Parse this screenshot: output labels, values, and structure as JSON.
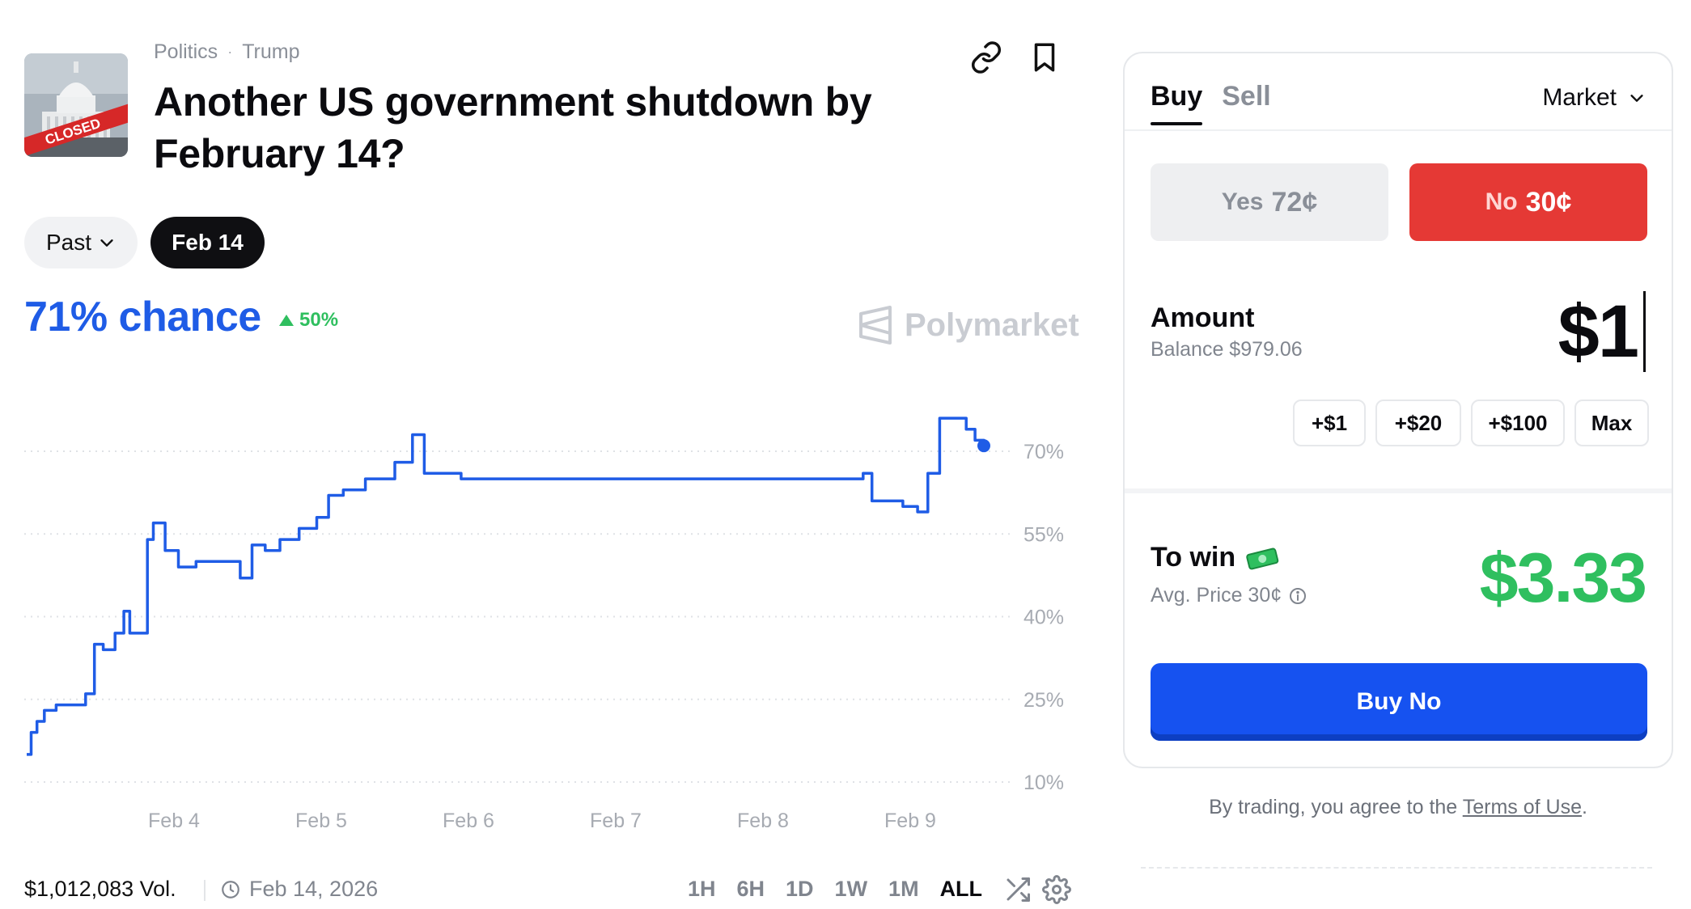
{
  "header": {
    "breadcrumb": [
      "Politics",
      "Trump"
    ],
    "breadcrumb_separator": "·",
    "title": "Another US government shutdown by February 14?",
    "thumbnail_text": "CLOSED"
  },
  "date_filter": {
    "past_label": "Past",
    "selected_label": "Feb 14"
  },
  "probability": {
    "chance_text": "71% chance",
    "change_text": "50%",
    "change_direction": "up",
    "watermark": "Polymarket"
  },
  "chart_data": {
    "type": "line",
    "xlabel": "",
    "ylabel": "",
    "x_ticks": [
      "Feb 4",
      "Feb 5",
      "Feb 6",
      "Feb 7",
      "Feb 8",
      "Feb 9"
    ],
    "y_ticks": [
      "70%",
      "55%",
      "40%",
      "25%",
      "10%"
    ],
    "ylim": [
      10,
      70
    ],
    "grid": true,
    "line_color": "#1f5ce6",
    "series": [
      {
        "values": [
          [
            3.0,
            15
          ],
          [
            3.03,
            19
          ],
          [
            3.07,
            21
          ],
          [
            3.12,
            23
          ],
          [
            3.2,
            24
          ],
          [
            3.35,
            24
          ],
          [
            3.4,
            26
          ],
          [
            3.46,
            35
          ],
          [
            3.52,
            34
          ],
          [
            3.6,
            37
          ],
          [
            3.66,
            41
          ],
          [
            3.7,
            37
          ],
          [
            3.77,
            37
          ],
          [
            3.82,
            54
          ],
          [
            3.86,
            57
          ],
          [
            3.94,
            52
          ],
          [
            4.03,
            49
          ],
          [
            4.15,
            50
          ],
          [
            4.35,
            50
          ],
          [
            4.45,
            47
          ],
          [
            4.53,
            53
          ],
          [
            4.62,
            52
          ],
          [
            4.72,
            54
          ],
          [
            4.85,
            56
          ],
          [
            4.97,
            58
          ],
          [
            5.05,
            62
          ],
          [
            5.15,
            63
          ],
          [
            5.3,
            65
          ],
          [
            5.5,
            68
          ],
          [
            5.62,
            73
          ],
          [
            5.7,
            66
          ],
          [
            5.95,
            65
          ],
          [
            6.2,
            65
          ],
          [
            6.5,
            65
          ],
          [
            6.7,
            65
          ],
          [
            6.9,
            65
          ],
          [
            7.1,
            65
          ],
          [
            7.4,
            65
          ],
          [
            7.65,
            65
          ],
          [
            7.9,
            65
          ],
          [
            8.1,
            65
          ],
          [
            8.4,
            65
          ],
          [
            8.68,
            66
          ],
          [
            8.74,
            61
          ],
          [
            8.95,
            60
          ],
          [
            9.05,
            59
          ],
          [
            9.12,
            66
          ],
          [
            9.2,
            76
          ],
          [
            9.28,
            76
          ],
          [
            9.38,
            74
          ],
          [
            9.44,
            72
          ],
          [
            9.5,
            71
          ]
        ]
      }
    ]
  },
  "footer": {
    "volume": "$1,012,083 Vol.",
    "end_date": "Feb 14, 2026",
    "ranges": [
      "1H",
      "6H",
      "1D",
      "1W",
      "1M",
      "ALL"
    ],
    "active_range": "ALL"
  },
  "trade": {
    "tab_buy": "Buy",
    "tab_sell": "Sell",
    "order_type": "Market",
    "yes_label": "Yes",
    "yes_price": "72¢",
    "no_label": "No",
    "no_price": "30¢",
    "amount_label": "Amount",
    "balance": "Balance $979.06",
    "amount_value": "$1",
    "quick_amounts": [
      "+$1",
      "+$20",
      "+$100",
      "Max"
    ],
    "to_win_label": "To win",
    "avg_price": "Avg. Price 30¢",
    "to_win_value": "$3.33",
    "buy_button": "Buy No"
  },
  "terms": {
    "text": "By trading, you agree to the",
    "link": "Terms of Use",
    "end": "."
  },
  "colors": {
    "accent_blue": "#1f5ce6",
    "button_blue": "#1652f0",
    "no_red": "#e53935",
    "win_green": "#2fbf5f"
  }
}
